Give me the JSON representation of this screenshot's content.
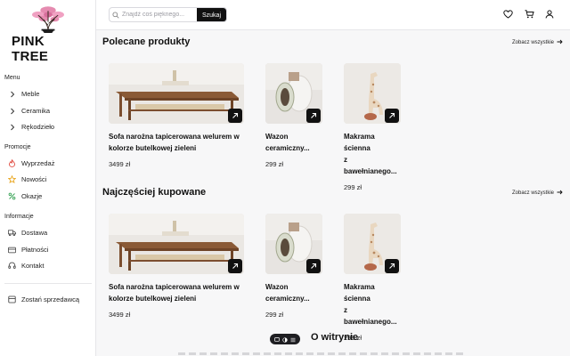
{
  "brand": {
    "name": "PINK TREE"
  },
  "header": {
    "search_placeholder": "Znajdź coś pięknego...",
    "search_button": "Szukaj",
    "icons": [
      "heart-icon",
      "cart-icon",
      "user-icon"
    ]
  },
  "sidebar": {
    "menu_title": "Menu",
    "menu_items": [
      {
        "label": "Meble",
        "icon": "chevron-right-icon"
      },
      {
        "label": "Ceramika",
        "icon": "chevron-right-icon"
      },
      {
        "label": "Rękodzieło",
        "icon": "chevron-right-icon"
      }
    ],
    "promo_title": "Promocje",
    "promo_items": [
      {
        "label": "Wyprzedaż",
        "icon": "flame-icon"
      },
      {
        "label": "Nowości",
        "icon": "star-icon"
      },
      {
        "label": "Okazje",
        "icon": "percent-icon"
      }
    ],
    "info_title": "Informacje",
    "info_items": [
      {
        "label": "Dostawa",
        "icon": "truck-icon"
      },
      {
        "label": "Płatności",
        "icon": "card-icon"
      },
      {
        "label": "Kontakt",
        "icon": "headset-icon"
      }
    ],
    "seller_link": "Zostań sprzedawcą"
  },
  "sections": [
    {
      "title": "Polecane produkty",
      "see_all": "Zobacz wszystkie",
      "products": [
        {
          "name_line1": "Sofa narożna tapicerowana welurem w",
          "name_line2": "kolorze butelkowej zieleni",
          "price": "3499 zł"
        },
        {
          "name_line1": "Wazon",
          "name_line2": "ceramiczny...",
          "price": "299 zł"
        },
        {
          "name_line1": "Makrama ścienna",
          "name_line2": "z bawełnianego...",
          "price": "299 zł"
        }
      ]
    },
    {
      "title": "Najczęściej kupowane",
      "see_all": "Zobacz wszystkie",
      "products": [
        {
          "name_line1": "Sofa narożna tapicerowana welurem w",
          "name_line2": "kolorze butelkowej zieleni",
          "price": "3499 zł"
        },
        {
          "name_line1": "Wazon",
          "name_line2": "ceramiczny...",
          "price": "299 zł"
        },
        {
          "name_line1": "Makrama ścienna",
          "name_line2": "z bawełnianego...",
          "price": "299 zł"
        }
      ]
    }
  ],
  "footer": {
    "title": "O witrynie"
  },
  "colors": {
    "accent": "#111111",
    "brand_pink": "#e58bb0",
    "background": "#f7f7f8"
  }
}
